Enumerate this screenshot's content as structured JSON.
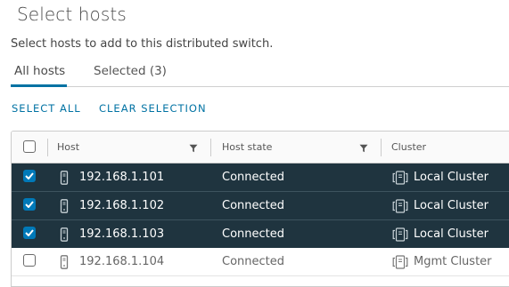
{
  "dialog": {
    "title": "Select hosts",
    "subtitle": "Select hosts to add to this distributed switch."
  },
  "tabs": [
    {
      "label": "All hosts",
      "active": true
    },
    {
      "label": "Selected (3)",
      "active": false
    }
  ],
  "actions": {
    "select_all": "SELECT ALL",
    "clear_selection": "CLEAR SELECTION"
  },
  "grid": {
    "columns": [
      {
        "label": "Host",
        "filterable": true
      },
      {
        "label": "Host state",
        "filterable": true
      },
      {
        "label": "Cluster",
        "filterable": false
      }
    ],
    "rows": [
      {
        "host": "192.168.1.101",
        "state": "Connected",
        "cluster": "Local Cluster",
        "selected": true
      },
      {
        "host": "192.168.1.102",
        "state": "Connected",
        "cluster": "Local Cluster",
        "selected": true
      },
      {
        "host": "192.168.1.103",
        "state": "Connected",
        "cluster": "Local Cluster",
        "selected": true
      },
      {
        "host": "192.168.1.104",
        "state": "Connected",
        "cluster": "Mgmt Cluster",
        "selected": false
      }
    ]
  },
  "icons": {
    "host": "host-server-icon",
    "cluster": "cluster-icon",
    "filter": "filter-funnel-icon",
    "check": "checkmark-icon"
  },
  "colors": {
    "accent": "#0072a3",
    "checkbox_checked": "#0079b8",
    "selected_row_bg": "#1f343f"
  }
}
